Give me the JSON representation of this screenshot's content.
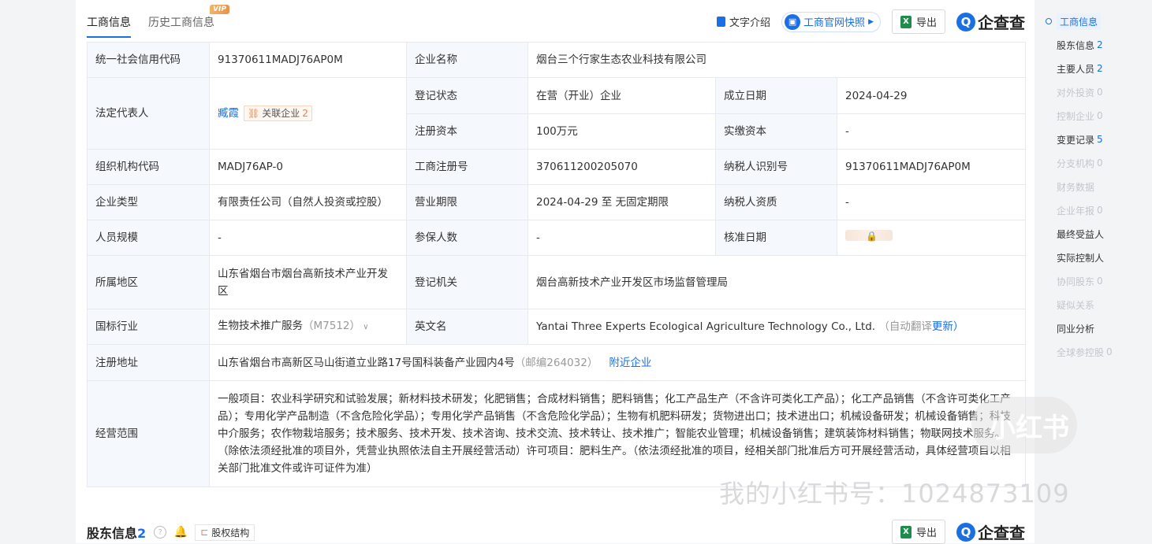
{
  "tabs": [
    {
      "label": "工商信息",
      "active": true
    },
    {
      "label": "历史工商信息",
      "active": false
    }
  ],
  "vip_badge": "VIP",
  "toolbar": {
    "text_intro": "文字介绍",
    "snapshot": "工商官网快照",
    "export": "导出",
    "xls_icon": "X",
    "brand": "企查查",
    "brand_icon": "Q"
  },
  "info": {
    "credit_code_label": "统一社会信用代码",
    "credit_code": "91370611MADJ76AP0M",
    "company_name_label": "企业名称",
    "company_name": "烟台三个行家生态农业科技有限公司",
    "legal_rep_label": "法定代表人",
    "legal_rep": "臧霞",
    "related_label": "关联企业",
    "related_count": "2",
    "reg_status_label": "登记状态",
    "reg_status": "在营（开业）企业",
    "founded_label": "成立日期",
    "founded": "2024-04-29",
    "reg_capital_label": "注册资本",
    "reg_capital": "100万元",
    "paid_capital_label": "实缴资本",
    "paid_capital": "-",
    "org_code_label": "组织机构代码",
    "org_code": "MADJ76AP-0",
    "biz_reg_no_label": "工商注册号",
    "biz_reg_no": "370611200205070",
    "taxpayer_id_label": "纳税人识别号",
    "taxpayer_id": "91370611MADJ76AP0M",
    "type_label": "企业类型",
    "type": "有限责任公司（自然人投资或控股）",
    "term_label": "营业期限",
    "term": "2024-04-29 至 无固定期限",
    "taxpayer_qual_label": "纳税人资质",
    "taxpayer_qual": "-",
    "staff_label": "人员规模",
    "staff": "-",
    "insured_label": "参保人数",
    "insured": "-",
    "approval_label": "核准日期",
    "region_label": "所属地区",
    "region": "山东省烟台市烟台高新技术产业开发区",
    "authority_label": "登记机关",
    "authority": "烟台高新技术产业开发区市场监督管理局",
    "industry_label": "国标行业",
    "industry": "生物技术推广服务",
    "industry_code": "（M7512）",
    "english_label": "英文名",
    "english": "Yantai Three Experts Ecological Agriculture Technology Co., Ltd.",
    "auto_translate": "（自动翻译",
    "update": "更新）",
    "address_label": "注册地址",
    "address": "山东省烟台市高新区马山街道立业路17号国科装备产业园内4号",
    "postcode": "（邮编264032）",
    "nearby": "附近企业",
    "scope_label": "经营范围",
    "scope": "一般项目：农业科学研究和试验发展；新材料技术研发；化肥销售；合成材料销售；肥料销售；化工产品生产（不含许可类化工产品）；化工产品销售（不含许可类化工产品）；专用化学产品制造（不含危险化学品）；专用化学产品销售（不含危险化学品）；生物有机肥料研发；货物进出口；技术进出口；机械设备研发；机械设备销售；科技中介服务；农作物栽培服务；技术服务、技术开发、技术咨询、技术交流、技术转让、技术推广；智能农业管理；机械设备销售；建筑装饰材料销售；物联网技术服务。（除依法须经批准的项目外，凭营业执照依法自主开展经营活动）许可项目：肥料生产。（依法须经批准的项目，经相关部门批准后方可开展经营活动，具体经营项目以相关部门批准文件或许可证件为准）"
  },
  "side_nav": [
    {
      "label": "工商信息",
      "count": "",
      "state": "active"
    },
    {
      "label": "股东信息",
      "count": "2",
      "state": "normal"
    },
    {
      "label": "主要人员",
      "count": "2",
      "state": "normal"
    },
    {
      "label": "对外投资",
      "count": "0",
      "state": "dim"
    },
    {
      "label": "控制企业",
      "count": "0",
      "state": "dim"
    },
    {
      "label": "变更记录",
      "count": "5",
      "state": "normal"
    },
    {
      "label": "分支机构",
      "count": "0",
      "state": "dim"
    },
    {
      "label": "财务数据",
      "count": "",
      "state": "dim"
    },
    {
      "label": "企业年报",
      "count": "0",
      "state": "dim"
    },
    {
      "label": "最终受益人",
      "count": "",
      "state": "normal"
    },
    {
      "label": "实际控制人",
      "count": "",
      "state": "normal"
    },
    {
      "label": "协同股东",
      "count": "0",
      "state": "dim"
    },
    {
      "label": "疑似关系",
      "count": "",
      "state": "dim"
    },
    {
      "label": "同业分析",
      "count": "",
      "state": "normal"
    },
    {
      "label": "全球参控股",
      "count": "0",
      "state": "dim"
    }
  ],
  "shareholder_section": {
    "title": "股东信息",
    "count": "2",
    "struct_label": "股权结构",
    "export": "导出",
    "brand": "企查查"
  },
  "watermark": {
    "logo_text": "小红书",
    "text": "我的小红书号：1024873109"
  }
}
